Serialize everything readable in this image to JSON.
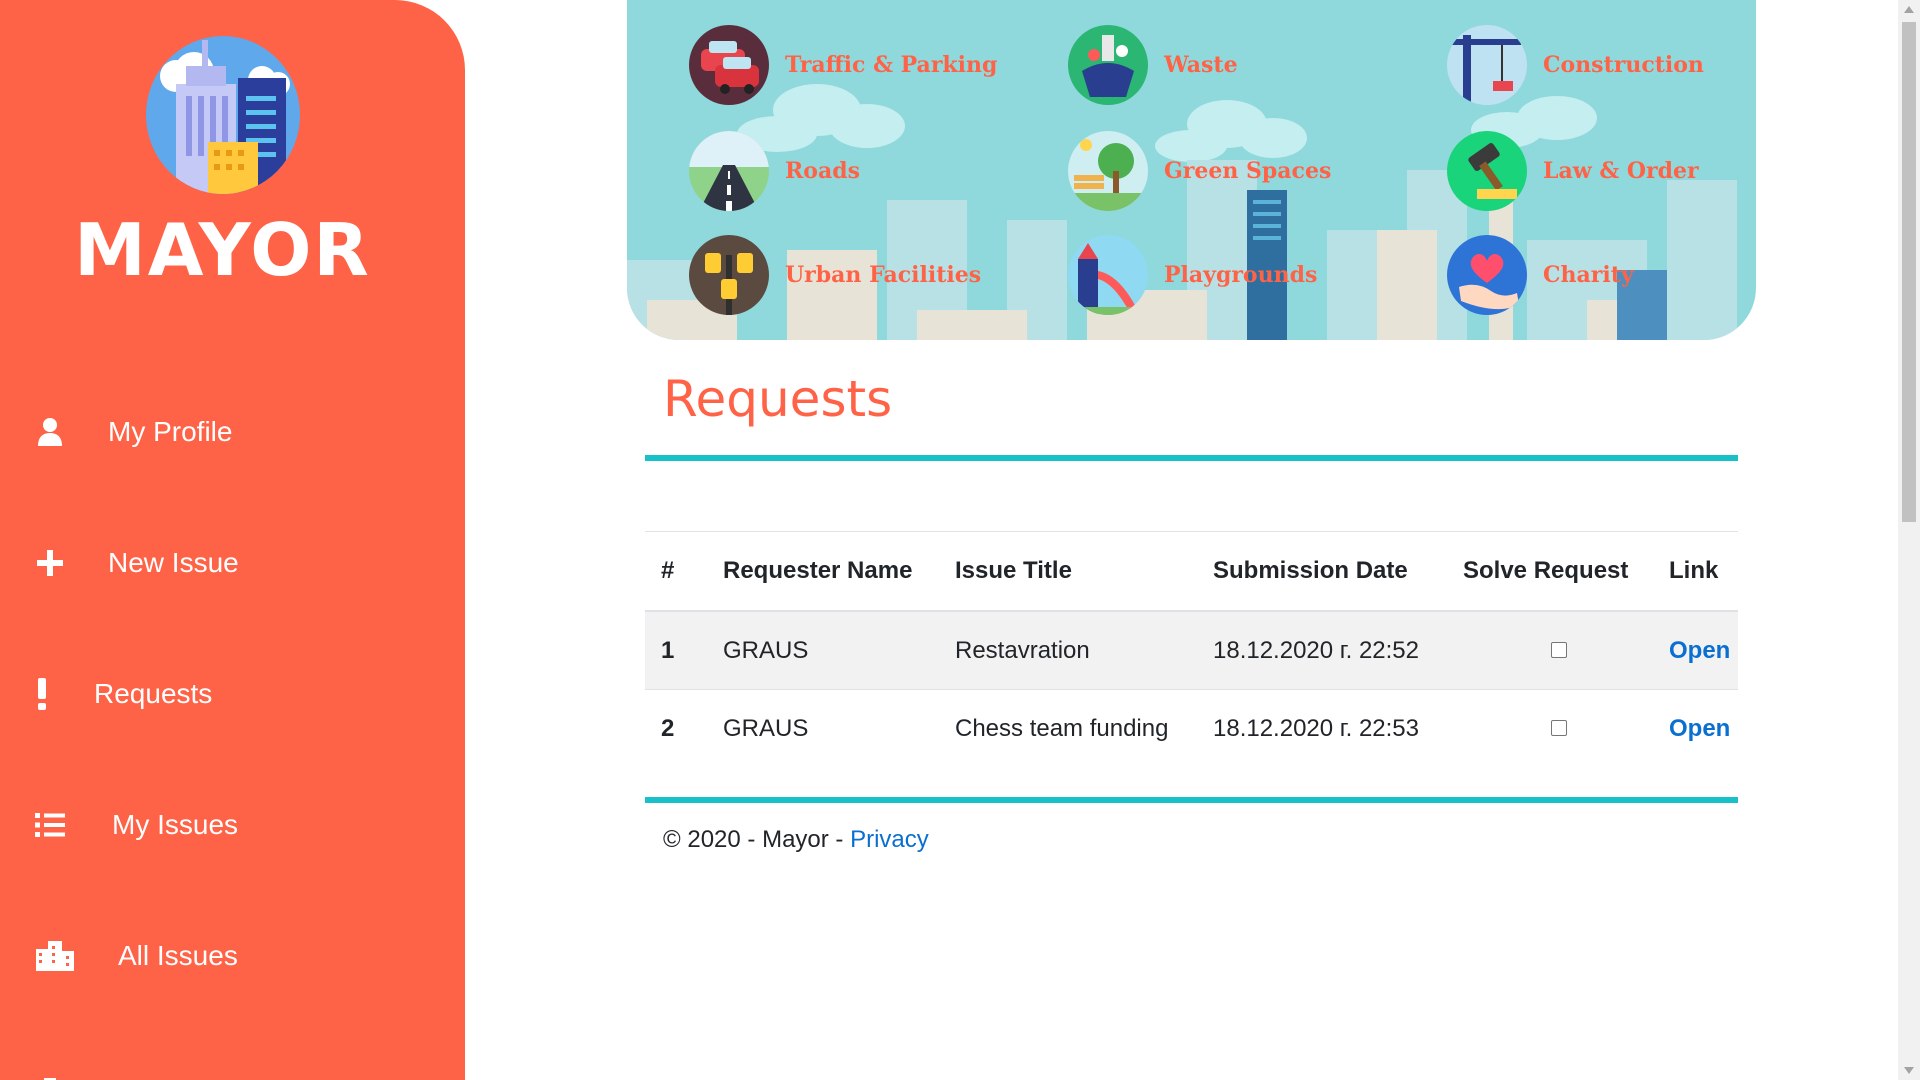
{
  "sidebar": {
    "brand": "MAYOR",
    "items": [
      {
        "label": "My Profile",
        "icon": "user-icon"
      },
      {
        "label": "New Issue",
        "icon": "plus-icon"
      },
      {
        "label": "Requests",
        "icon": "exclamation-icon"
      },
      {
        "label": "My Issues",
        "icon": "list-icon"
      },
      {
        "label": "All Issues",
        "icon": "city-icon"
      }
    ]
  },
  "categories": [
    {
      "label": "Traffic & Parking",
      "icon": "car-icon"
    },
    {
      "label": "Waste",
      "icon": "waste-icon"
    },
    {
      "label": "Construction",
      "icon": "crane-icon"
    },
    {
      "label": "Roads",
      "icon": "road-icon"
    },
    {
      "label": "Green Spaces",
      "icon": "tree-icon"
    },
    {
      "label": "Law & Order",
      "icon": "gavel-icon"
    },
    {
      "label": "Urban Facilities",
      "icon": "street-lamp-icon"
    },
    {
      "label": "Playgrounds",
      "icon": "slide-icon"
    },
    {
      "label": "Charity",
      "icon": "heart-hands-icon"
    }
  ],
  "page": {
    "title": "Requests"
  },
  "table": {
    "headers": {
      "num": "#",
      "requester": "Requester Name",
      "title": "Issue Title",
      "date": "Submission Date",
      "solve": "Solve Request",
      "link": "Link"
    },
    "rows": [
      {
        "num": "1",
        "requester": "GRAUS",
        "title": "Restavration",
        "date": "18.12.2020 г. 22:52",
        "solved": false,
        "link": "Open"
      },
      {
        "num": "2",
        "requester": "GRAUS",
        "title": "Chess team funding",
        "date": "18.12.2020 г. 22:53",
        "solved": false,
        "link": "Open"
      }
    ]
  },
  "footer": {
    "text": "© 2020 - Mayor - ",
    "privacy": "Privacy"
  },
  "colors": {
    "accent": "#ff6347",
    "teal": "#17c1c7",
    "banner": "#8fd9dc",
    "link": "#0a6fd1"
  }
}
